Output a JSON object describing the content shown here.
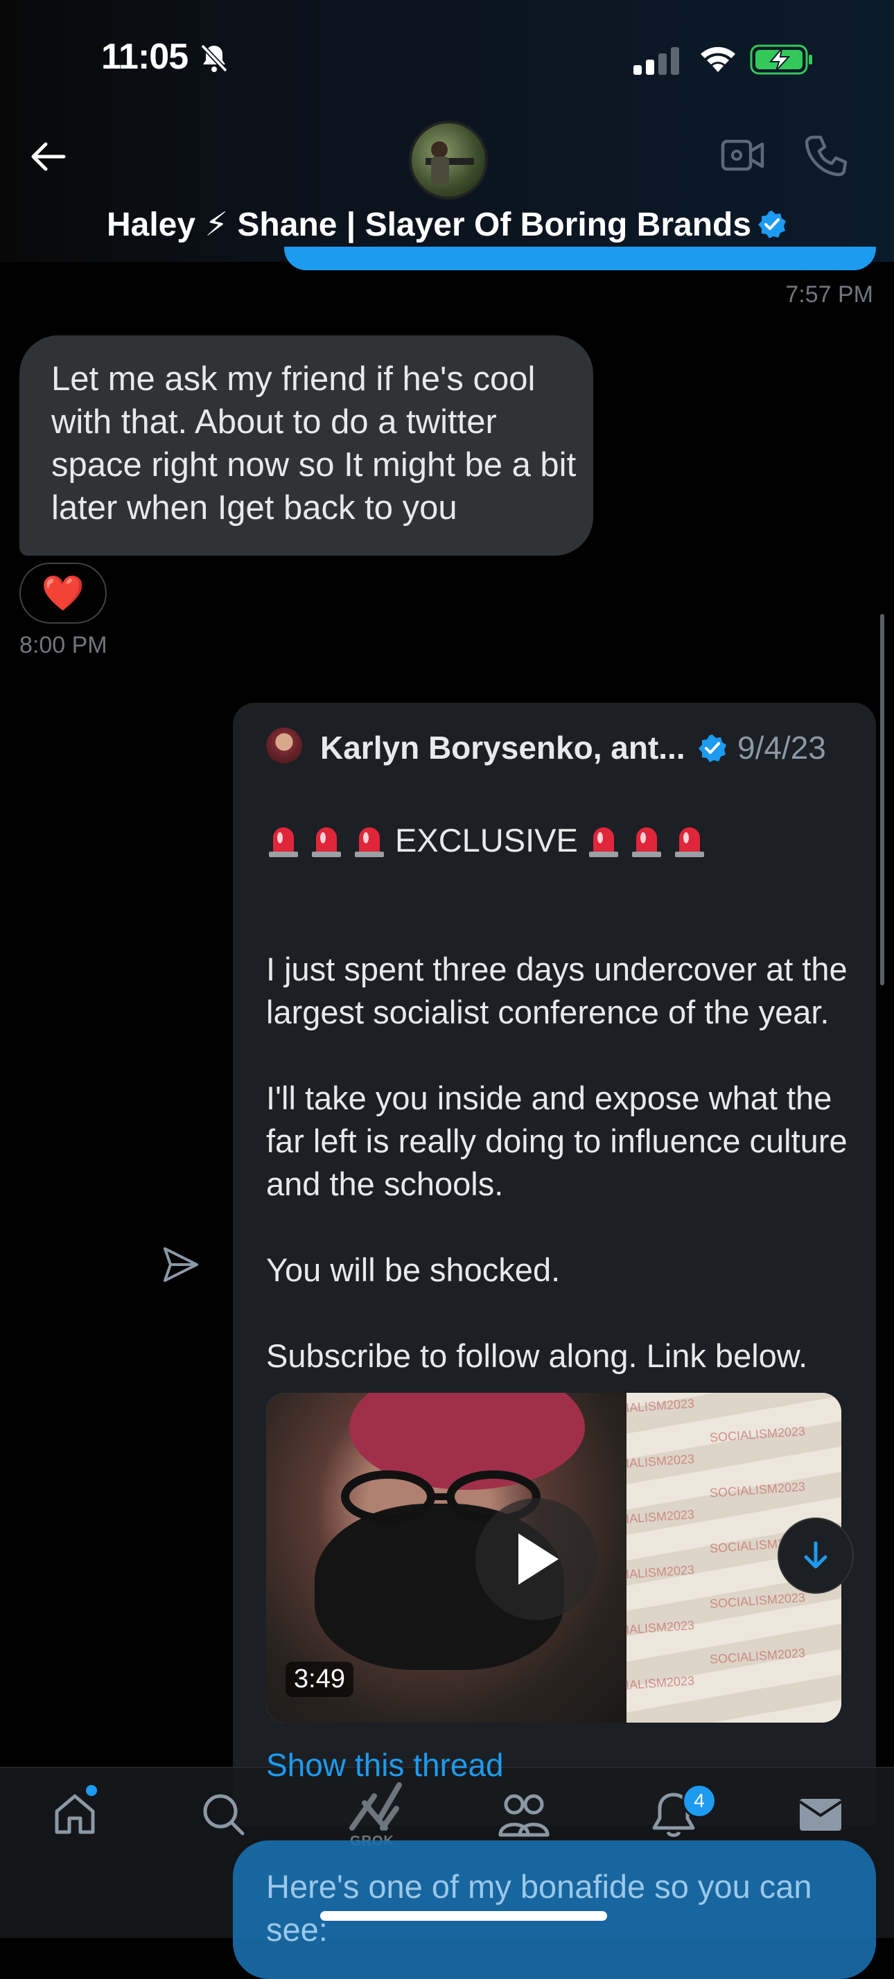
{
  "status_bar": {
    "time": "11:05"
  },
  "header": {
    "contact_name": "Haley ⚡ Shane | Slayer Of Boring Brands"
  },
  "messages": {
    "prev_time": "7:57 PM",
    "received_text": "Let me ask my friend if he's cool with that. About to do a twitter space right now so It might be a bit later when  Iget back to you",
    "reaction": "❤️",
    "received_time": "8:00 PM"
  },
  "shared_post": {
    "author": "Karlyn Borysenko, ant...",
    "date": "9/4/23",
    "headline": "EXCLUSIVE",
    "body": "I just spent three days undercover at the largest socialist conference of the year.\n\nI'll take you inside and expose what the far left is really doing to influence culture and the schools.\n\nYou will be shocked.\n\nSubscribe to follow along. Link below.",
    "pointing_emoji": "👇",
    "video_duration": "3:49",
    "wall_text": "SOCIALISM2023",
    "show_thread": "Show this thread"
  },
  "next_message": {
    "text": "Here's one of my bonafide so you can see:"
  },
  "nav": {
    "grok_label": "GROK",
    "notification_count": "4",
    "items": [
      "home-icon",
      "search-icon",
      "grok-icon",
      "communities-icon",
      "notifications-icon",
      "messages-icon"
    ]
  },
  "colors": {
    "accent": "#1d9bf0",
    "bubble_received": "#2f3336",
    "card_bg": "#1c1f23"
  }
}
